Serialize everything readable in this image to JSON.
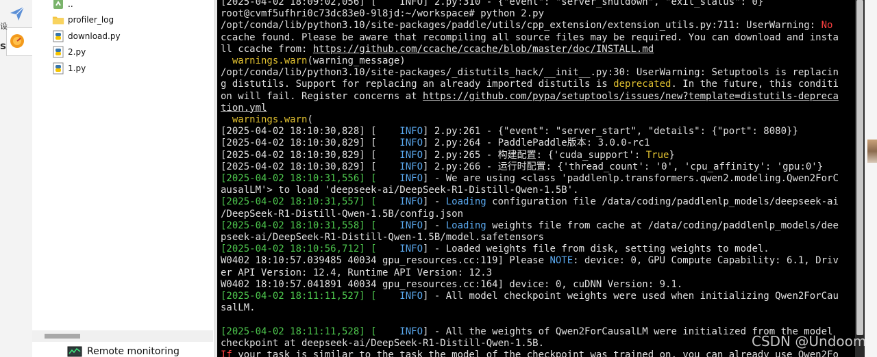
{
  "sidebar": {
    "glyphs": [
      "设",
      "s"
    ]
  },
  "file_tree": {
    "items": [
      {
        "name": "..",
        "kind": "parent"
      },
      {
        "name": "profiler_log",
        "kind": "folder"
      },
      {
        "name": "download.py",
        "kind": "python"
      },
      {
        "name": "2.py",
        "kind": "python"
      },
      {
        "name": "1.py",
        "kind": "python"
      }
    ]
  },
  "bottom_panel": {
    "label": "Remote monitoring"
  },
  "terminal": {
    "lines": [
      [
        {
          "t": "[2025-04-02 18:09:02,056] [    INFO] 2.py:310 - {\"event\": \"server_shutdown\", \"exit_status\": 0}"
        }
      ],
      [
        {
          "t": "root@cvmf5ufhri0c73dc83e0-9l8jd:~/workspace# python 2.py"
        }
      ],
      [
        {
          "t": "/opt/conda/lib/python3.10/site-packages/paddle/utils/cpp_extension/extension_utils.py:711: UserWarning: "
        },
        {
          "t": "No",
          "c": "r"
        }
      ],
      [
        {
          "t": "ccache found. Please be aware that recompiling all source files may be required. You can download and insta"
        }
      ],
      [
        {
          "t": "ll ccache from: "
        },
        {
          "t": "https://github.com/ccache/ccache/blob/master/doc/INSTALL.md",
          "c": "u"
        }
      ],
      [
        {
          "t": "  "
        },
        {
          "t": "warnings.warn",
          "c": "y"
        },
        {
          "t": "(warning_message)"
        }
      ],
      [
        {
          "t": "/opt/conda/lib/python3.10/site-packages/_distutils_hack/__init__.py:30: UserWarning: Setuptools is replacin"
        }
      ],
      [
        {
          "t": "g distutils. Support for replacing an already imported distutils is "
        },
        {
          "t": "deprecated",
          "c": "y"
        },
        {
          "t": ". In the future, this conditi"
        }
      ],
      [
        {
          "t": "on will fail. Register concerns at "
        },
        {
          "t": "https://github.com/pypa/setuptools/issues/new?template=distutils-depreca",
          "c": "u"
        }
      ],
      [
        {
          "t": "tion.yml",
          "c": "u"
        }
      ],
      [
        {
          "t": "  "
        },
        {
          "t": "warnings.warn",
          "c": "y"
        },
        {
          "t": "("
        }
      ],
      [
        {
          "t": "[2025-04-02 18:10:30,828] [    "
        },
        {
          "t": "INFO",
          "c": "c"
        },
        {
          "t": "] 2.py:261 - {\"event\": \"server_start\", \"details\": {\"port\": 8080}}"
        }
      ],
      [
        {
          "t": "[2025-04-02 18:10:30,829] [    "
        },
        {
          "t": "INFO",
          "c": "c"
        },
        {
          "t": "] 2.py:264 - PaddlePaddle版本: 3.0.0-rc1"
        }
      ],
      [
        {
          "t": "[2025-04-02 18:10:30,829] [    "
        },
        {
          "t": "INFO",
          "c": "c"
        },
        {
          "t": "] 2.py:265 - 构建配置: {'cuda_support': "
        },
        {
          "t": "True",
          "c": "y"
        },
        {
          "t": "}"
        }
      ],
      [
        {
          "t": "[2025-04-02 18:10:30,829] [    "
        },
        {
          "t": "INFO",
          "c": "c"
        },
        {
          "t": "] 2.py:266 - 运行时配置: {'thread_count': '0', 'cpu_affinity': 'gpu:0'}"
        }
      ],
      [
        {
          "t": "[2025-04-02 18:10:31,556] [",
          "c": "g"
        },
        {
          "t": "    "
        },
        {
          "t": "INFO",
          "c": "c"
        },
        {
          "t": "] - We are using <class 'paddlenlp.transformers.qwen2.modeling.Qwen2ForC"
        }
      ],
      [
        {
          "t": "ausalLM'> to load 'deepseek-ai/DeepSeek-R1-Distill-Qwen-1.5B'."
        }
      ],
      [
        {
          "t": "[2025-04-02 18:10:31,557] [",
          "c": "g"
        },
        {
          "t": "    "
        },
        {
          "t": "INFO",
          "c": "c"
        },
        {
          "t": "] - "
        },
        {
          "t": "Loading",
          "c": "c"
        },
        {
          "t": " configuration file /data/coding/paddlenlp_models/deepseek-ai"
        }
      ],
      [
        {
          "t": "/DeepSeek-R1-Distill-Qwen-1.5B/config.json"
        }
      ],
      [
        {
          "t": "[2025-04-02 18:10:31,558] [",
          "c": "g"
        },
        {
          "t": "    "
        },
        {
          "t": "INFO",
          "c": "c"
        },
        {
          "t": "] - "
        },
        {
          "t": "Loading",
          "c": "c"
        },
        {
          "t": " weights file from cache at /data/coding/paddlenlp_models/dee"
        }
      ],
      [
        {
          "t": "pseek-ai/DeepSeek-R1-Distill-Qwen-1.5B/model.safetensors"
        }
      ],
      [
        {
          "t": "[2025-04-02 18:10:56,712] [",
          "c": "g"
        },
        {
          "t": "    "
        },
        {
          "t": "INFO",
          "c": "c"
        },
        {
          "t": "] - Loaded weights file from disk, setting weights to model."
        }
      ],
      [
        {
          "t": "W0402 18:10:57.039485 40034 gpu_resources.cc:119] Please "
        },
        {
          "t": "NOTE",
          "c": "c"
        },
        {
          "t": ": device: 0, GPU Compute Capability: 6.1, Driv"
        }
      ],
      [
        {
          "t": "er API Version: 12.4, Runtime API Version: 12.3"
        }
      ],
      [
        {
          "t": "W0402 18:10:57.041891 40034 gpu_resources.cc:164] device: 0, cuDNN Version: 9.1."
        }
      ],
      [
        {
          "t": "[2025-04-02 18:11:11,527] [",
          "c": "g"
        },
        {
          "t": "    "
        },
        {
          "t": "INFO",
          "c": "c"
        },
        {
          "t": "] - All model checkpoint weights were used when initializing Qwen2ForCau"
        }
      ],
      [
        {
          "t": "salLM."
        }
      ],
      [
        {
          "t": ""
        }
      ],
      [
        {
          "t": "[2025-04-02 18:11:11,528] [",
          "c": "g"
        },
        {
          "t": "    "
        },
        {
          "t": "INFO",
          "c": "c"
        },
        {
          "t": "] - All the weights of Qwen2ForCausalLM were initialized from the model"
        }
      ],
      [
        {
          "t": "checkpoint at deepseek-ai/DeepSeek-R1-Distill-Qwen-1.5B."
        }
      ],
      [
        {
          "t": "If",
          "c": "r"
        },
        {
          "t": " your task is similar to the task the model of the checkpoint was trained on, you can already use Qwen2Fo"
        }
      ]
    ]
  },
  "watermark": "CSDN @Undoom"
}
